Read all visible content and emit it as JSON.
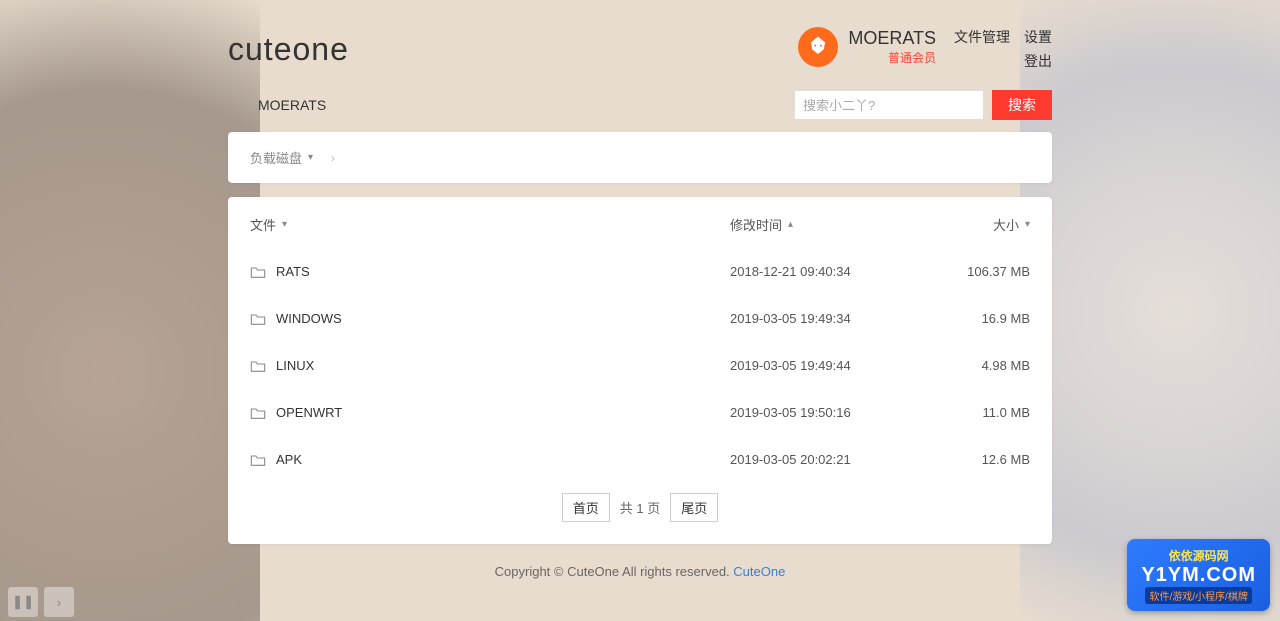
{
  "logo": "cuteone",
  "user": {
    "name": "MOERATS",
    "role": "普通会员"
  },
  "nav": {
    "file_manage": "文件管理",
    "settings": "设置",
    "logout": "登出"
  },
  "breadcrumb_top": "MOERATS",
  "search": {
    "placeholder": "搜索小二丫?",
    "button": "搜索"
  },
  "crumb": {
    "disk": "负载磁盘"
  },
  "columns": {
    "file": "文件",
    "mtime": "修改时间",
    "size": "大小"
  },
  "files": [
    {
      "name": "RATS",
      "mtime": "2018-12-21 09:40:34",
      "size": "106.37 MB"
    },
    {
      "name": "WINDOWS",
      "mtime": "2019-03-05 19:49:34",
      "size": "16.9 MB"
    },
    {
      "name": "LINUX",
      "mtime": "2019-03-05 19:49:44",
      "size": "4.98 MB"
    },
    {
      "name": "OPENWRT",
      "mtime": "2019-03-05 19:50:16",
      "size": "11.0 MB"
    },
    {
      "name": "APK",
      "mtime": "2019-03-05 20:02:21",
      "size": "12.6 MB"
    }
  ],
  "pagination": {
    "first": "首页",
    "info": "共 1 页",
    "last": "尾页"
  },
  "footer": {
    "copyright": "Copyright © CuteOne All rights reserved. ",
    "link": "CuteOne"
  },
  "watermark": {
    "top": "依依源码网",
    "mid": "Y1YM.COM",
    "bot": "软件/游戏/小程序/棋牌"
  }
}
